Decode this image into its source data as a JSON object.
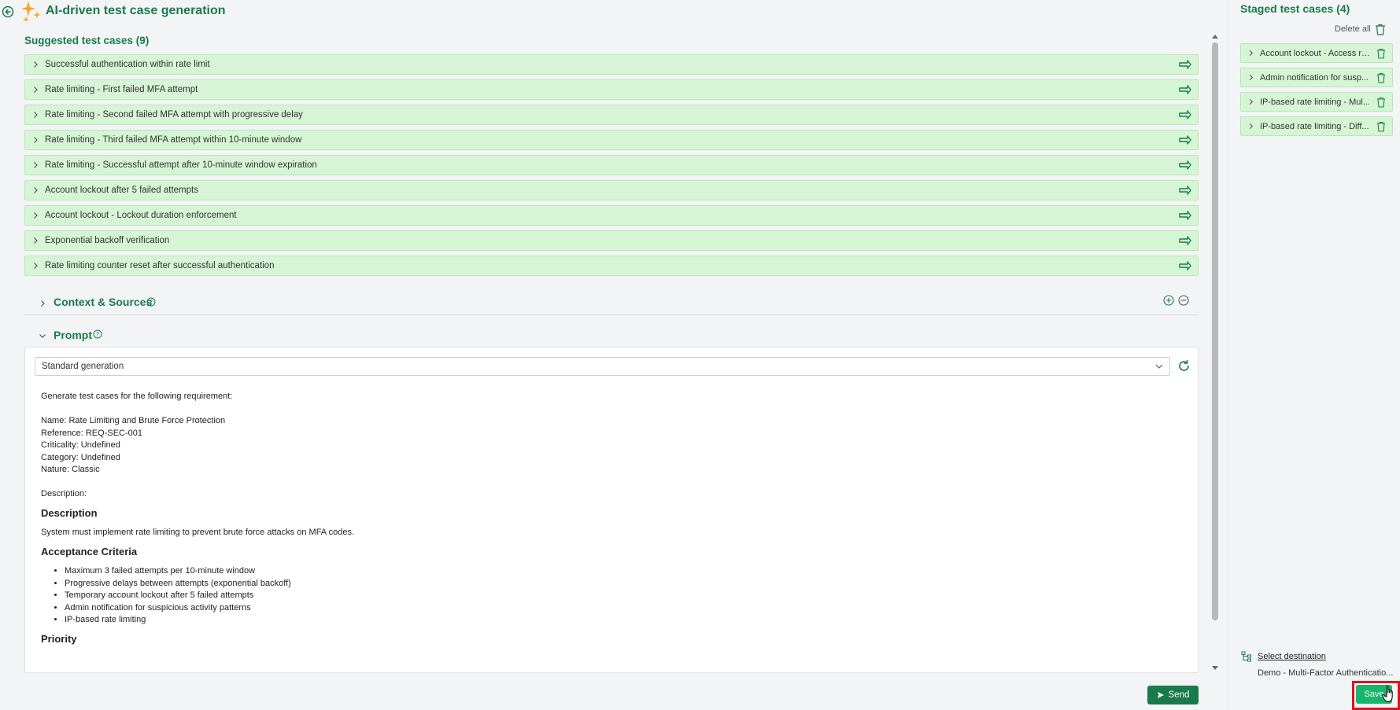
{
  "header": {
    "title": "AI-driven test case generation"
  },
  "suggested": {
    "title": "Suggested test cases (9)",
    "items": [
      "Successful authentication within rate limit",
      "Rate limiting - First failed MFA attempt",
      "Rate limiting - Second failed MFA attempt with progressive delay",
      "Rate limiting - Third failed MFA attempt within 10-minute window",
      "Rate limiting - Successful attempt after 10-minute window expiration",
      "Account lockout after 5 failed attempts",
      "Account lockout - Lockout duration enforcement",
      "Exponential backoff verification",
      "Rate limiting counter reset after successful authentication"
    ]
  },
  "context": {
    "title": "Context & Sources"
  },
  "prompt": {
    "title": "Prompt",
    "selected_template": "Standard generation",
    "intro": "Generate test cases for the following requirement:",
    "name_line": "Name: Rate Limiting and Brute Force Protection",
    "reference_line": "Reference: REQ-SEC-001",
    "criticality_line": "Criticality: Undefined",
    "category_line": "Category: Undefined",
    "nature_line": "Nature: Classic",
    "description_label": "Description:",
    "description_heading": "Description",
    "description_text": "System must implement rate limiting to prevent brute force attacks on MFA codes.",
    "acceptance_heading": "Acceptance Criteria",
    "criteria": [
      "Maximum 3 failed attempts per 10-minute window",
      "Progressive delays between attempts (exponential backoff)",
      "Temporary account lockout after 5 failed attempts",
      "Admin notification for suspicious activity patterns",
      "IP-based rate limiting"
    ],
    "priority_heading": "Priority",
    "send_label": "Send"
  },
  "staged": {
    "title": "Staged test cases (4)",
    "delete_all_label": "Delete all",
    "items": [
      "Account lockout - Access re...",
      "Admin notification for susp...",
      "IP-based rate limiting - Mul...",
      "IP-based rate limiting - Diff..."
    ],
    "select_destination_label": "Select destination",
    "destination_path": "Demo - Multi-Factor Authenticatio...",
    "save_label": "Save"
  },
  "colors": {
    "accent": "#1b7a4b",
    "row_bg": "#d5f5d5",
    "save_bg": "#17b66a",
    "highlight": "#e0131c"
  }
}
